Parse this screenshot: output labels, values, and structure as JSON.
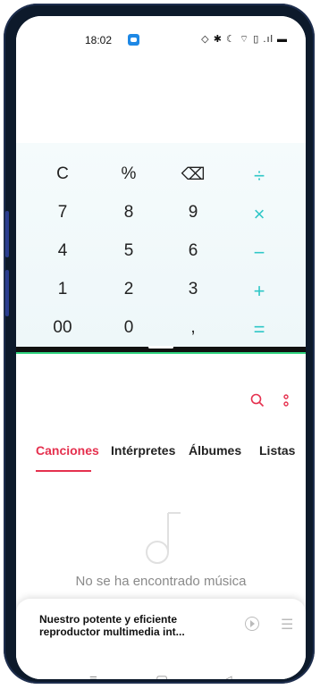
{
  "status_bar": {
    "time": "18:02",
    "icons": "◇ ✱ ☾ ⌔ ▯ .ıl ▬"
  },
  "calculator": {
    "rows": [
      [
        "C",
        "%",
        "⌫",
        "÷"
      ],
      [
        "7",
        "8",
        "9",
        "×"
      ],
      [
        "4",
        "5",
        "6",
        "−"
      ],
      [
        "1",
        "2",
        "3",
        "+"
      ],
      [
        "00",
        "0",
        ",",
        "="
      ]
    ]
  },
  "music": {
    "tabs": [
      "Canciones",
      "Intérpretes",
      "Álbumes",
      "Listas"
    ],
    "active_tab": "Canciones",
    "empty_message": "No se ha encontrado música",
    "promo_text": "Nuestro potente y eficiente reproductor multimedia int..."
  },
  "nav": {
    "menu": "≡",
    "home": "▢",
    "back": "◁"
  },
  "colors": {
    "accent_red": "#e5304e",
    "calc_operator": "#2fc7c7",
    "divider_green": "#2fd37f"
  }
}
